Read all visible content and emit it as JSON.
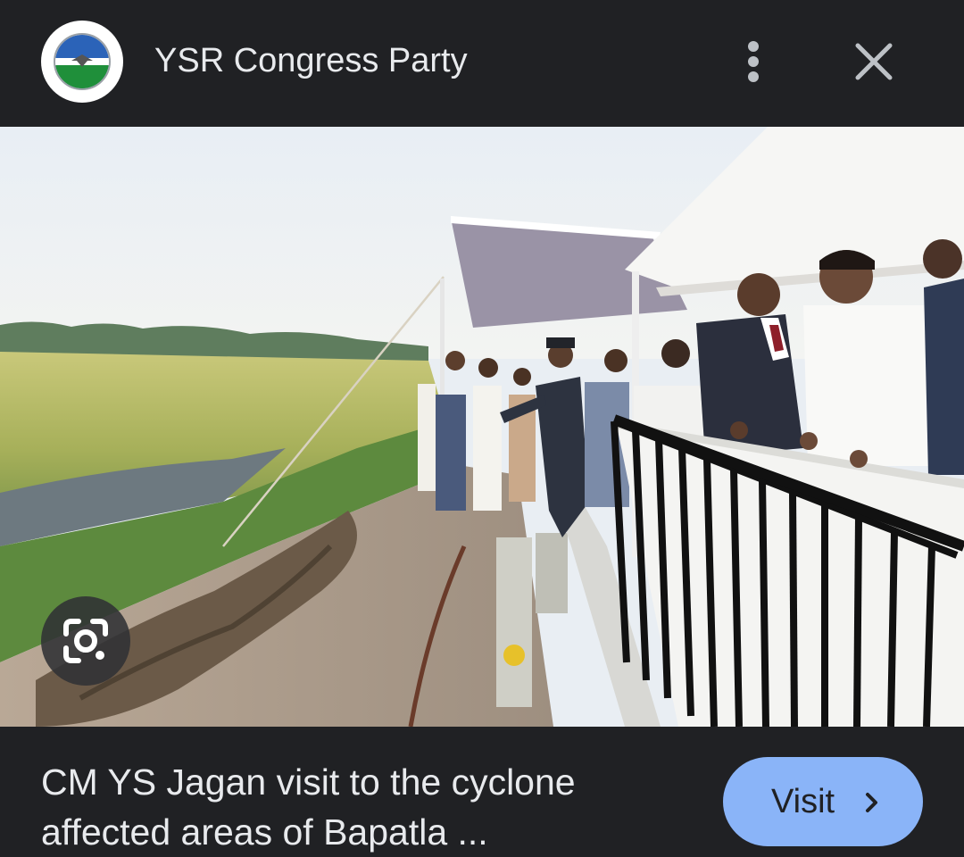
{
  "header": {
    "title": "YSR Congress Party",
    "avatar_icon": "ysrcp-flag-logo",
    "menu_icon": "more-vert-icon",
    "close_icon": "close-icon"
  },
  "image": {
    "description_icon": "news-photo",
    "lens_icon": "google-lens-icon"
  },
  "caption": {
    "line1": "CM YS Jagan visit to the cyclone",
    "line2": "affected areas of Bapatla ..."
  },
  "actions": {
    "visit_label": "Visit",
    "visit_icon": "chevron-right-icon"
  },
  "colors": {
    "background": "#202124",
    "text": "#e8eaed",
    "accent": "#8ab4f8",
    "flag_blue": "#2b63b8",
    "flag_green": "#1f8f3a"
  }
}
